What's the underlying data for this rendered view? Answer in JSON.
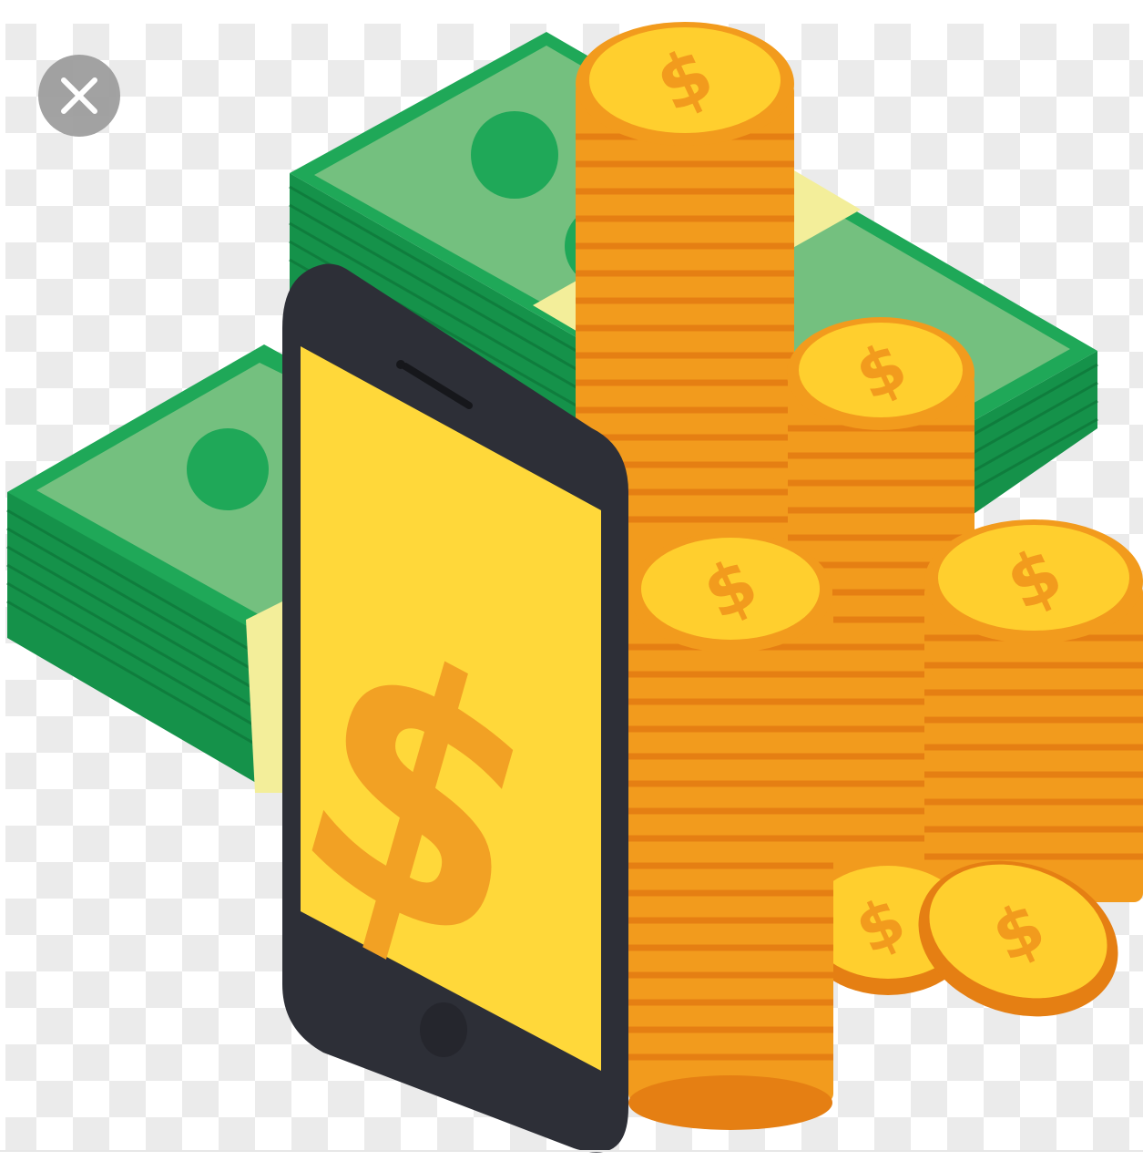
{
  "viewer": {
    "close_icon": "close-icon"
  },
  "illustration": {
    "symbol": "$",
    "colors": {
      "checker_light": "#ffffff",
      "checker_dark": "#e9e9e9",
      "bill_dark": "#15924a",
      "bill_mid": "#1fa858",
      "bill_light": "#6fbf7c",
      "band": "#f3ee9a",
      "phone_body": "#2d2f37",
      "phone_screen": "#ffd83a",
      "symbol_on_phone": "#f2a124",
      "coin_face": "#ffcf2e",
      "coin_edge": "#f29b1d",
      "coin_edge_dark": "#e57f13"
    }
  }
}
